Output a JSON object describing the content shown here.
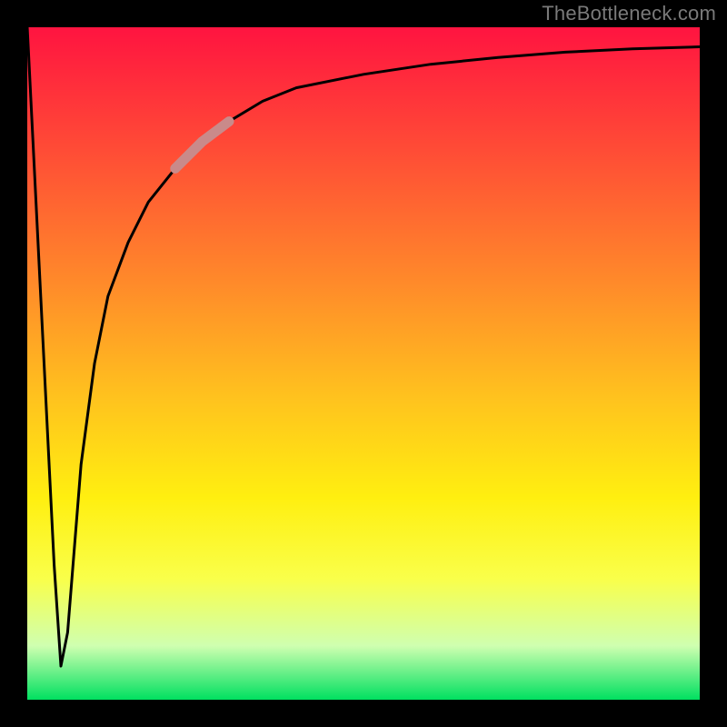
{
  "watermark": "TheBottleneck.com",
  "colors": {
    "frame": "#000000",
    "watermark_text": "#7a7a7a",
    "curve_stroke": "#000000",
    "highlight_stroke": "#c98a8a",
    "gradient_stops": [
      "#ff1440",
      "#ff4b36",
      "#ff8a2a",
      "#ffc21e",
      "#ffef10",
      "#f9ff4a",
      "#cfffb0",
      "#00e060"
    ]
  },
  "chart_data": {
    "type": "line",
    "title": "",
    "xlabel": "",
    "ylabel": "",
    "xlim": [
      0,
      100
    ],
    "ylim": [
      0,
      100
    ],
    "grid": false,
    "legend": false,
    "annotations": [
      {
        "kind": "highlight_segment",
        "x_range": [
          22,
          30
        ],
        "note": "thick pale segment on upper part of curve"
      }
    ],
    "series": [
      {
        "name": "curve",
        "x": [
          0,
          2,
          4,
          5,
          6,
          8,
          10,
          12,
          15,
          18,
          22,
          26,
          30,
          35,
          40,
          50,
          60,
          70,
          80,
          90,
          100
        ],
        "y": [
          100,
          60,
          20,
          5,
          10,
          35,
          50,
          60,
          68,
          74,
          79,
          83,
          86,
          89,
          91,
          93,
          94.5,
          95.5,
          96.3,
          96.8,
          97.1
        ]
      }
    ]
  }
}
